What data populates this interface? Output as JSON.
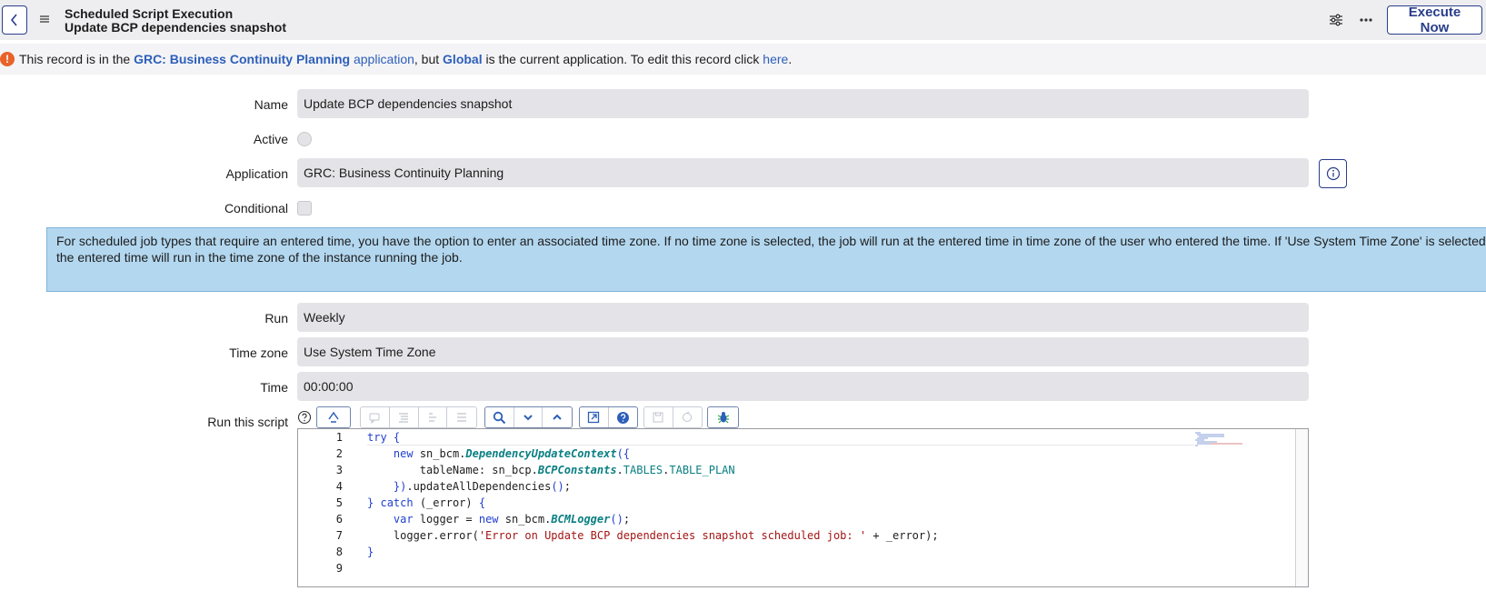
{
  "header": {
    "title_line1": "Scheduled Script Execution",
    "title_line2": "Update BCP dependencies snapshot",
    "execute_label": "Execute Now"
  },
  "warning": {
    "prefix": "This record is in the ",
    "app_name": "GRC: Business Continuity Planning",
    "app_link": "application",
    "middle": ", but ",
    "current_app": "Global",
    "suffix": " is the current application. To edit this record click ",
    "here_link": "here",
    "end": "."
  },
  "form": {
    "name_label": "Name",
    "name_value": "Update BCP dependencies snapshot",
    "active_label": "Active",
    "application_label": "Application",
    "application_value": "GRC: Business Continuity Planning",
    "conditional_label": "Conditional",
    "info_text": "For scheduled job types that require an entered time, you have the option to enter an associated time zone. If no time zone is selected, the job will run at the entered time in time zone of the user who entered the time. If 'Use System Time Zone' is selected, the entered time will run in the time zone of the instance running the job.",
    "run_label": "Run",
    "run_value": "Weekly",
    "timezone_label": "Time zone",
    "timezone_value": "Use System Time Zone",
    "time_label": "Time",
    "time_value": "00:00:00",
    "script_label": "Run this script"
  },
  "script": {
    "line_numbers": [
      "1",
      "2",
      "3",
      "4",
      "5",
      "6",
      "7",
      "8",
      "9"
    ]
  },
  "colors": {
    "accent": "#293e8a",
    "link": "#2d5fba",
    "warning": "#e8622a",
    "info_bg": "#b3d7ef",
    "field_bg": "#e4e4e8"
  }
}
